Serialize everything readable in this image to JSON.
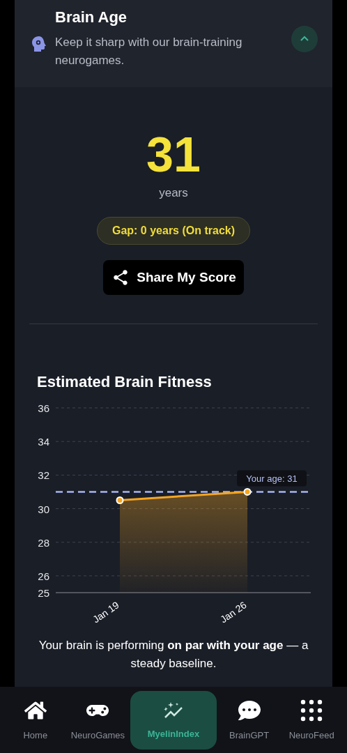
{
  "header": {
    "title": "Brain Age",
    "subtitle": "Keep it sharp with our brain-training neurogames.",
    "expanded": true
  },
  "score": {
    "value": "31",
    "unit": "years",
    "badge": "Gap: 0 years (On track)",
    "share_button": "Share My Score"
  },
  "chart": {
    "title": "Estimated Brain Fitness",
    "chart_data": {
      "type": "area",
      "categories": [
        "Jan 19",
        "Jan 26"
      ],
      "series": [
        {
          "color": "#f5a623",
          "values": [
            30.5,
            31
          ]
        }
      ],
      "ylim": [
        25,
        36
      ],
      "yticks": [
        25,
        26,
        28,
        30,
        32,
        34,
        36
      ],
      "grid": true,
      "ref_lines": [
        {
          "axis": "y",
          "value": 31,
          "label": "Your age: 31"
        }
      ]
    },
    "summary": "Your brain is performing **on par with your age** — a steady baseline."
  },
  "nav": [
    {
      "label": "Home",
      "selected": false
    },
    {
      "label": "NeuroGames",
      "selected": false
    },
    {
      "label": "MyelinIndex",
      "selected": true
    },
    {
      "label": "BrainGPT",
      "selected": false
    },
    {
      "label": "NeuroFeed",
      "selected": false
    }
  ]
}
